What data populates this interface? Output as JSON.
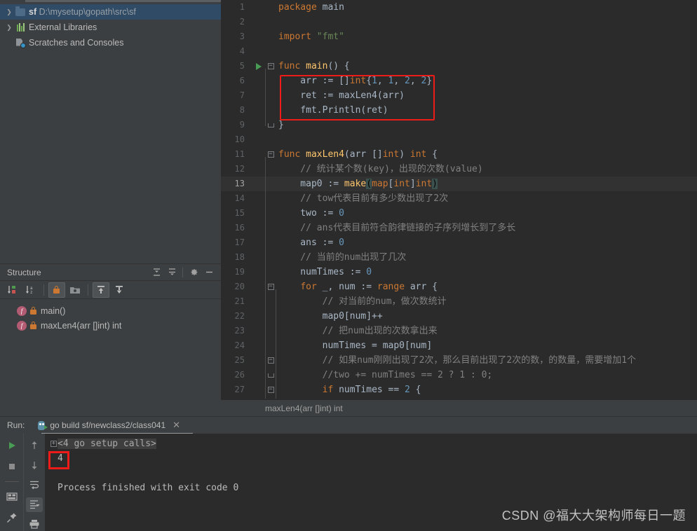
{
  "project_tree": {
    "items": [
      {
        "icon": "folder-icon",
        "arrow": "›",
        "name": "sf",
        "path": "D:\\mysetup\\gopath\\src\\sf",
        "selected": true
      },
      {
        "icon": "library-icon",
        "arrow": "›",
        "name": "External Libraries",
        "path": "",
        "selected": false
      },
      {
        "icon": "scratches-icon",
        "arrow": "",
        "name": "Scratches and Consoles",
        "path": "",
        "selected": false
      }
    ]
  },
  "structure": {
    "title": "Structure",
    "header_buttons": [
      "expand-all-icon",
      "collapse-all-icon",
      "settings-gear-icon",
      "hide-icon"
    ],
    "toolbar_buttons": [
      "sort-by-visibility-icon",
      "sort-alphabetically-icon",
      "show-non-public-icon",
      "group-icon",
      "show-inherited-icon",
      "show-anonymous-icon"
    ],
    "items": [
      {
        "icon": "function-icon",
        "lock": "lock-icon",
        "label": "main()"
      },
      {
        "icon": "function-icon",
        "lock": "lock-icon",
        "label": "maxLen4(arr []int) int"
      }
    ]
  },
  "editor": {
    "breadcrumb": "maxLen4(arr []int) int",
    "highlighted_line": 13,
    "run_marker_line": 5,
    "lines": [
      {
        "n": 1,
        "tokens": [
          {
            "t": "kw",
            "s": "package"
          },
          {
            "t": "txt",
            "s": " main"
          }
        ]
      },
      {
        "n": 2,
        "tokens": []
      },
      {
        "n": 3,
        "tokens": [
          {
            "t": "kw",
            "s": "import"
          },
          {
            "t": "txt",
            "s": " "
          },
          {
            "t": "str",
            "s": "\"fmt\""
          }
        ]
      },
      {
        "n": 4,
        "tokens": []
      },
      {
        "n": 5,
        "tokens": [
          {
            "t": "kw",
            "s": "func"
          },
          {
            "t": "txt",
            "s": " "
          },
          {
            "t": "fn",
            "s": "main"
          },
          {
            "t": "txt",
            "s": "() {"
          }
        ]
      },
      {
        "n": 6,
        "tokens": [
          {
            "t": "txt",
            "s": "    arr := []"
          },
          {
            "t": "typ",
            "s": "int"
          },
          {
            "t": "txt",
            "s": "{"
          },
          {
            "t": "num",
            "s": "1"
          },
          {
            "t": "txt",
            "s": ", "
          },
          {
            "t": "num",
            "s": "1"
          },
          {
            "t": "txt",
            "s": ", "
          },
          {
            "t": "num",
            "s": "2"
          },
          {
            "t": "txt",
            "s": ", "
          },
          {
            "t": "num",
            "s": "2"
          },
          {
            "t": "txt",
            "s": "}"
          }
        ]
      },
      {
        "n": 7,
        "tokens": [
          {
            "t": "txt",
            "s": "    ret := "
          },
          {
            "t": "txt",
            "s": "maxLen4(arr)"
          }
        ]
      },
      {
        "n": 8,
        "tokens": [
          {
            "t": "txt",
            "s": "    fmt."
          },
          {
            "t": "txt",
            "s": "Println(ret)"
          }
        ]
      },
      {
        "n": 9,
        "tokens": [
          {
            "t": "txt",
            "s": "}"
          }
        ]
      },
      {
        "n": 10,
        "tokens": []
      },
      {
        "n": 11,
        "tokens": [
          {
            "t": "kw",
            "s": "func"
          },
          {
            "t": "txt",
            "s": " "
          },
          {
            "t": "fn",
            "s": "maxLen4"
          },
          {
            "t": "txt",
            "s": "(arr []"
          },
          {
            "t": "typ",
            "s": "int"
          },
          {
            "t": "txt",
            "s": ") "
          },
          {
            "t": "typ",
            "s": "int"
          },
          {
            "t": "txt",
            "s": " {"
          }
        ]
      },
      {
        "n": 12,
        "tokens": [
          {
            "t": "cmt",
            "s": "    // 统计某个数(key)，出现的次数(value)"
          }
        ]
      },
      {
        "n": 13,
        "tokens": [
          {
            "t": "txt",
            "s": "    map0 := "
          },
          {
            "t": "fn",
            "s": "make"
          },
          {
            "t": "brmatch",
            "s": "("
          },
          {
            "t": "typ",
            "s": "map"
          },
          {
            "t": "txt",
            "s": "["
          },
          {
            "t": "typ",
            "s": "int"
          },
          {
            "t": "txt",
            "s": "]"
          },
          {
            "t": "typ",
            "s": "int"
          },
          {
            "t": "brmatch",
            "s": ")"
          }
        ]
      },
      {
        "n": 14,
        "tokens": [
          {
            "t": "cmt",
            "s": "    // tow代表目前有多少数出现了2次"
          }
        ]
      },
      {
        "n": 15,
        "tokens": [
          {
            "t": "txt",
            "s": "    two := "
          },
          {
            "t": "num",
            "s": "0"
          }
        ]
      },
      {
        "n": 16,
        "tokens": [
          {
            "t": "cmt",
            "s": "    // ans代表目前符合韵律链接的子序列增长到了多长"
          }
        ]
      },
      {
        "n": 17,
        "tokens": [
          {
            "t": "txt",
            "s": "    ans := "
          },
          {
            "t": "num",
            "s": "0"
          }
        ]
      },
      {
        "n": 18,
        "tokens": [
          {
            "t": "cmt",
            "s": "    // 当前的num出现了几次"
          }
        ]
      },
      {
        "n": 19,
        "tokens": [
          {
            "t": "txt",
            "s": "    numTimes := "
          },
          {
            "t": "num",
            "s": "0"
          }
        ]
      },
      {
        "n": 20,
        "tokens": [
          {
            "t": "txt",
            "s": "    "
          },
          {
            "t": "kw",
            "s": "for"
          },
          {
            "t": "txt",
            "s": " _, num := "
          },
          {
            "t": "kw",
            "s": "range"
          },
          {
            "t": "txt",
            "s": " arr {"
          }
        ]
      },
      {
        "n": 21,
        "tokens": [
          {
            "t": "cmt",
            "s": "        // 对当前的num，做次数统计"
          }
        ]
      },
      {
        "n": 22,
        "tokens": [
          {
            "t": "txt",
            "s": "        map0[num]++"
          }
        ]
      },
      {
        "n": 23,
        "tokens": [
          {
            "t": "cmt",
            "s": "        // 把num出现的次数拿出来"
          }
        ]
      },
      {
        "n": 24,
        "tokens": [
          {
            "t": "txt",
            "s": "        numTimes = map0[num]"
          }
        ]
      },
      {
        "n": 25,
        "tokens": [
          {
            "t": "cmt",
            "s": "        // 如果num刚刚出现了2次，那么目前出现了2次的数，的数量，需要增加1个"
          }
        ]
      },
      {
        "n": 26,
        "tokens": [
          {
            "t": "cmt",
            "s": "        //two += numTimes == 2 ? 1 : 0;"
          }
        ]
      },
      {
        "n": 27,
        "tokens": [
          {
            "t": "txt",
            "s": "        "
          },
          {
            "t": "kw",
            "s": "if"
          },
          {
            "t": "txt",
            "s": " numTimes == "
          },
          {
            "t": "num",
            "s": "2"
          },
          {
            "t": "txt",
            "s": " {"
          }
        ]
      }
    ]
  },
  "run_panel": {
    "run_label": "Run:",
    "tab_title": "go build sf/newclass2/class041",
    "tab_icon": "go-run-icon",
    "close_icon": "close-icon",
    "toolbar_left": [
      "rerun-play-icon",
      "stop-icon",
      "layout-icon",
      "pin-icon"
    ],
    "toolbar_mid": [
      "up-arrow-icon",
      "down-arrow-icon",
      "soft-wrap-icon",
      "scroll-to-end-icon",
      "print-icon"
    ],
    "console": {
      "collapsed_node": "<4 go setup calls>",
      "output_value": "4",
      "exit_message": "Process finished with exit code 0"
    }
  },
  "watermark": "CSDN @福大大架构师每日一题",
  "colors": {
    "highlight_box": "#ee1c18",
    "selection_bg": "#2f4b66",
    "editor_bg": "#2b2b2b",
    "panel_bg": "#3c3f41",
    "keyword": "#cc7832",
    "string": "#6a8759",
    "number": "#6897bb",
    "comment": "#808080",
    "function": "#ffc66d",
    "text": "#a9b7c6"
  }
}
